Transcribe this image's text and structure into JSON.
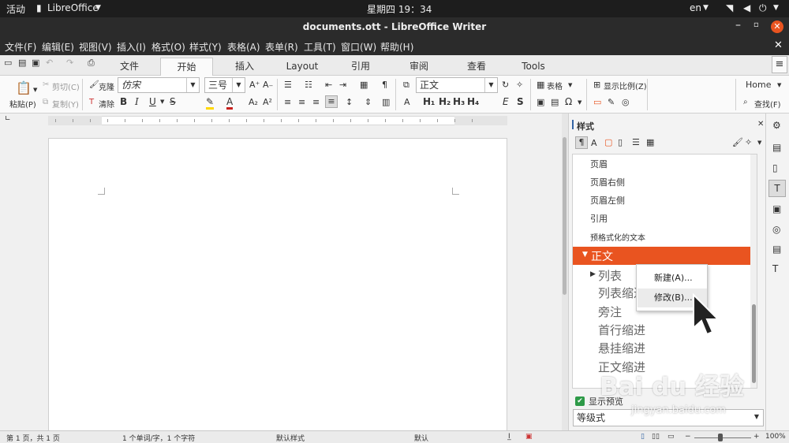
{
  "topbar": {
    "activities": "活动",
    "app": "LibreOffice",
    "clock": "星期四 19：34",
    "lang": "en"
  },
  "window": {
    "title": "documents.ott - LibreOffice Writer"
  },
  "menu": [
    "文件(F)",
    "编辑(E)",
    "视图(V)",
    "插入(I)",
    "格式(O)",
    "样式(Y)",
    "表格(A)",
    "表单(R)",
    "工具(T)",
    "窗口(W)",
    "帮助(H)"
  ],
  "tabs": [
    "文件",
    "开始",
    "插入",
    "Layout",
    "引用",
    "审阅",
    "查看",
    "Tools"
  ],
  "ribbon": {
    "cut": "剪切(C)",
    "copy": "复制(Y)",
    "paste": "粘贴(P)",
    "clone": "克隆",
    "clear": "清除",
    "font": "仿宋",
    "size": "三号",
    "para_style": "正文",
    "table": "表格",
    "zoom": "显示比例(Z)",
    "home": "Home",
    "find": "查找(F)",
    "bold": "B",
    "italic": "I",
    "underline": "U",
    "strike": "S",
    "h1": "H₁",
    "h2": "H₂",
    "h3": "H₃",
    "h4": "H₄",
    "emph": "E",
    "strong": "S"
  },
  "sidebar": {
    "title": "样式",
    "styles": [
      "页眉",
      "页眉右侧",
      "页眉左侧",
      "引用",
      "预格式化的文本",
      "正文",
      "列表",
      "列表缩进",
      "旁注",
      "首行缩进",
      "悬挂缩进",
      "正文缩进"
    ],
    "selected": "正文",
    "show_preview": "显示预览",
    "filter": "等级式"
  },
  "context_menu": [
    "新建(A)...",
    "修改(B)..."
  ],
  "status": {
    "page": "第 1 页，共 1 页",
    "words": "1 个单词/字，1 个字符",
    "page_style": "默认样式",
    "lang": "默认",
    "zoom": "100%"
  },
  "watermark": {
    "brand": "Bai du 经验",
    "url": "jingyan.baidu.com"
  },
  "colors": {
    "accent": "#e95420",
    "topbar": "#1d1d1d",
    "titlebar": "#2b2b2b"
  }
}
